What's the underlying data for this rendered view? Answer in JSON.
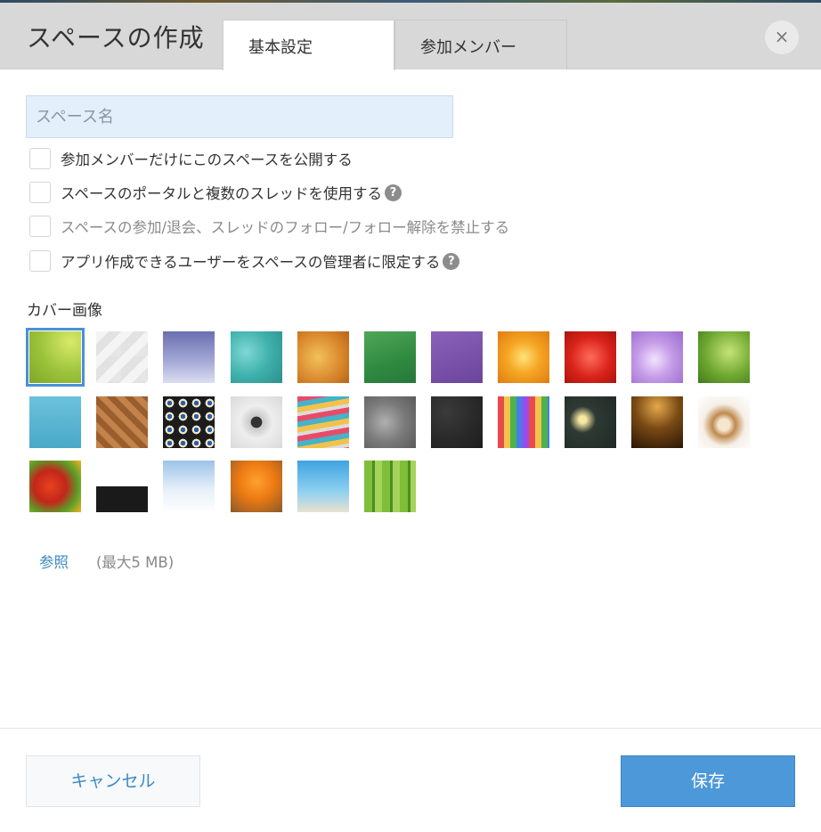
{
  "dialog": {
    "title": "スペースの作成",
    "close_label": "×"
  },
  "tabs": [
    {
      "label": "基本設定",
      "active": true
    },
    {
      "label": "参加メンバー",
      "active": false
    }
  ],
  "form": {
    "space_name_placeholder": "スペース名",
    "space_name_value": "",
    "options": [
      {
        "label": "参加メンバーだけにこのスペースを公開する",
        "checked": false,
        "disabled": false,
        "help": false
      },
      {
        "label": "スペースのポータルと複数のスレッドを使用する",
        "checked": false,
        "disabled": false,
        "help": true
      },
      {
        "label": "スペースの参加/退会、スレッドのフォロー/フォロー解除を禁止する",
        "checked": false,
        "disabled": true,
        "help": false
      },
      {
        "label": "アプリ作成できるユーザーをスペースの管理者に限定する",
        "checked": false,
        "disabled": false,
        "help": true
      }
    ],
    "help_glyph": "?"
  },
  "cover": {
    "label": "カバー画像",
    "selected_index": 0,
    "images": [
      "lime-green-abstract",
      "white-geometric",
      "purple-blue-gradient",
      "teal-texture",
      "orange-grunge",
      "green-fabric",
      "purple-paper",
      "orange-flower",
      "red-flower",
      "lavender-flower",
      "green-leaf",
      "white-cubes",
      "wicker-weave",
      "mosaic-tiles",
      "compass",
      "stacked-books",
      "gears",
      "chalkboard-doodles",
      "colored-pencils",
      "lightbulb-chalkboard",
      "dark-amber-gradient",
      "latte-art",
      "vegetables",
      "cat-peeking",
      "snowy-trees",
      "oranges-basket",
      "palm-beach",
      "bamboo"
    ],
    "browse_label": "参照",
    "max_size_text": "(最大5 MB)"
  },
  "footer": {
    "cancel_label": "キャンセル",
    "save_label": "保存"
  },
  "colors": {
    "accent": "#4d98d8",
    "link": "#3b8bc6",
    "header_bg": "#d8d8d8",
    "input_bg": "#e3effb"
  }
}
